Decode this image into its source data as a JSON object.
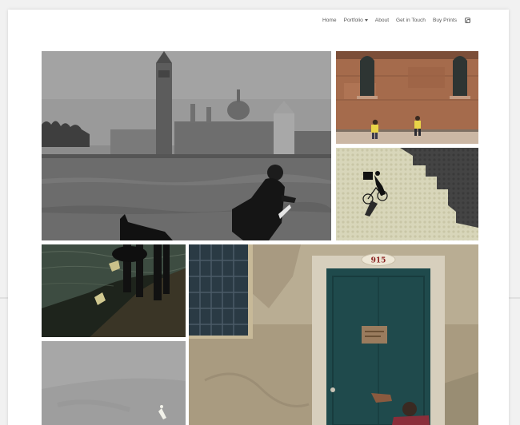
{
  "nav": {
    "items": [
      {
        "label": "Home"
      },
      {
        "label": "Portfolio",
        "has_dropdown": true
      },
      {
        "label": "About"
      },
      {
        "label": "Get in Touch"
      },
      {
        "label": "Buy Prints"
      }
    ],
    "social_icon": "instagram-icon"
  },
  "gallery": {
    "door_number": "915"
  },
  "colors": {
    "nav_text": "#595959",
    "door_teal": "#1f4a4c",
    "brick": "#a76a4c",
    "background": "#ffffff"
  }
}
